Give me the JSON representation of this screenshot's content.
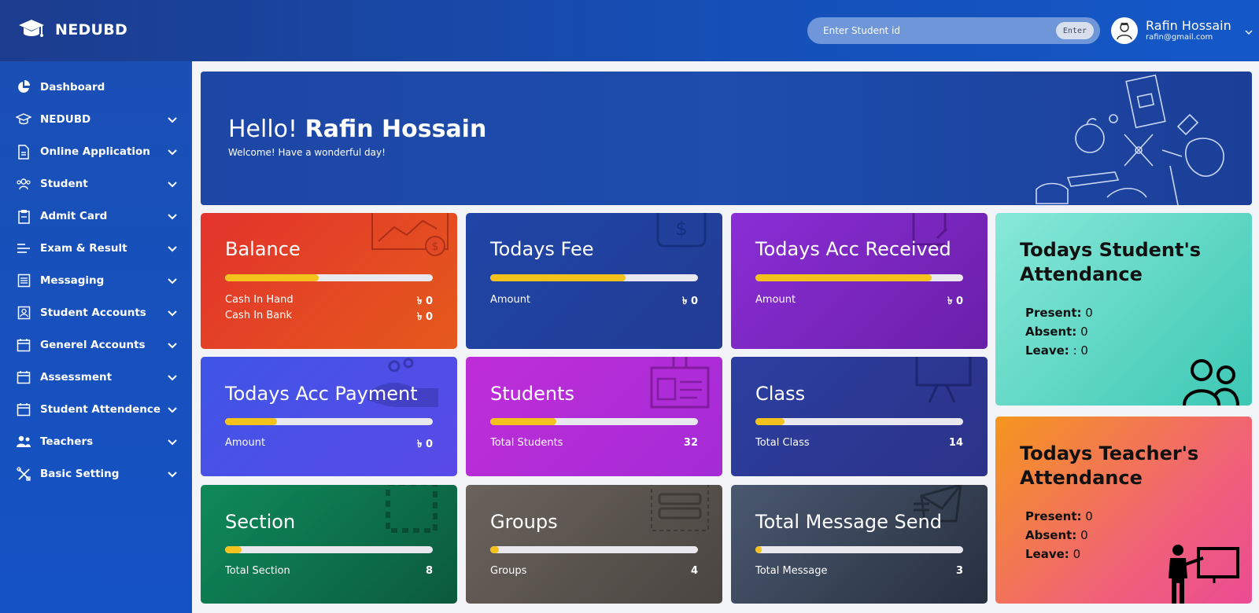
{
  "header": {
    "brand": "NEDUBD",
    "search_placeholder": "Enter Student id",
    "search_button": "Enter",
    "user_name": "Rafin Hossain",
    "user_email": "rafin@gmail.com"
  },
  "sidebar": {
    "items": [
      {
        "label": "Dashboard",
        "icon": "pie-chart-icon"
      },
      {
        "label": "NEDUBD",
        "icon": "graduation-cap-icon"
      },
      {
        "label": "Online Application",
        "icon": "document-icon"
      },
      {
        "label": "Student",
        "icon": "users-icon"
      },
      {
        "label": "Admit Card",
        "icon": "clipboard-icon"
      },
      {
        "label": "Exam & Result",
        "icon": "list-icon"
      },
      {
        "label": "Messaging",
        "icon": "message-icon"
      },
      {
        "label": "Student Accounts",
        "icon": "id-card-icon"
      },
      {
        "label": "Generel Accounts",
        "icon": "calendar-icon"
      },
      {
        "label": "Assessment",
        "icon": "calendar-icon"
      },
      {
        "label": "Student Attendence",
        "icon": "calendar-icon"
      },
      {
        "label": "Teachers",
        "icon": "teachers-icon"
      },
      {
        "label": "Basic Setting",
        "icon": "tools-icon"
      }
    ]
  },
  "banner": {
    "greeting": "Hello!",
    "name": "Rafin Hossain",
    "subtitle": "Welcome! Have a wonderful day!"
  },
  "cards": {
    "balance": {
      "title": "Balance",
      "progress": 0.45,
      "rows": [
        {
          "label": "Cash In Hand",
          "value": "৳ 0"
        },
        {
          "label": "Cash In Bank",
          "value": "৳ 0"
        }
      ]
    },
    "todays_fee": {
      "title": "Todays Fee",
      "progress": 0.65,
      "rows": [
        {
          "label": "Amount",
          "value": "৳ 0"
        }
      ]
    },
    "acc_received": {
      "title": "Todays Acc Received",
      "progress": 0.85,
      "rows": [
        {
          "label": "Amount",
          "value": "৳ 0"
        }
      ]
    },
    "acc_payment": {
      "title": "Todays Acc Payment",
      "progress": 0.25,
      "rows": [
        {
          "label": "Amount",
          "value": "৳ 0"
        }
      ]
    },
    "students": {
      "title": "Students",
      "progress": 0.32,
      "rows": [
        {
          "label": "Total Students",
          "value": "32"
        }
      ]
    },
    "class": {
      "title": "Class",
      "progress": 0.14,
      "rows": [
        {
          "label": "Total Class",
          "value": "14"
        }
      ]
    },
    "section": {
      "title": "Section",
      "progress": 0.08,
      "rows": [
        {
          "label": "Total Section",
          "value": "8"
        }
      ]
    },
    "groups": {
      "title": "Groups",
      "progress": 0.04,
      "rows": [
        {
          "label": "Groups",
          "value": "4"
        }
      ]
    },
    "messages": {
      "title": "Total Message Send",
      "progress": 0.03,
      "rows": [
        {
          "label": "Total Message",
          "value": "3"
        }
      ]
    }
  },
  "attendance": {
    "student": {
      "title": "Todays Student's Attendance",
      "present_label": "Present:",
      "present": "0",
      "absent_label": "Absent:",
      "absent": "0",
      "leave_label": "Leave:",
      "leave": ": 0"
    },
    "teacher": {
      "title": "Todays Teacher's Attendance",
      "present_label": "Present:",
      "present": "0",
      "absent_label": "Absent:",
      "absent": "0",
      "leave_label": "Leave:",
      "leave": "0"
    }
  },
  "colors": {
    "header": "#1550b8",
    "sidebar": "#1a4fb6",
    "progress_fill": "#f4c21c",
    "balance": "#e0422a",
    "todays_fee": "#1e3f9a",
    "acc_received": "#7a2bc8",
    "acc_payment": "#4a4fe0",
    "students": "#b52fd8",
    "class": "#2a3a9a",
    "section": "#0f7a52",
    "groups": "#5a5550",
    "messages": "#3a4658",
    "student_attendance": "#4ad6c2",
    "teacher_attendance": "#f27a6a"
  }
}
